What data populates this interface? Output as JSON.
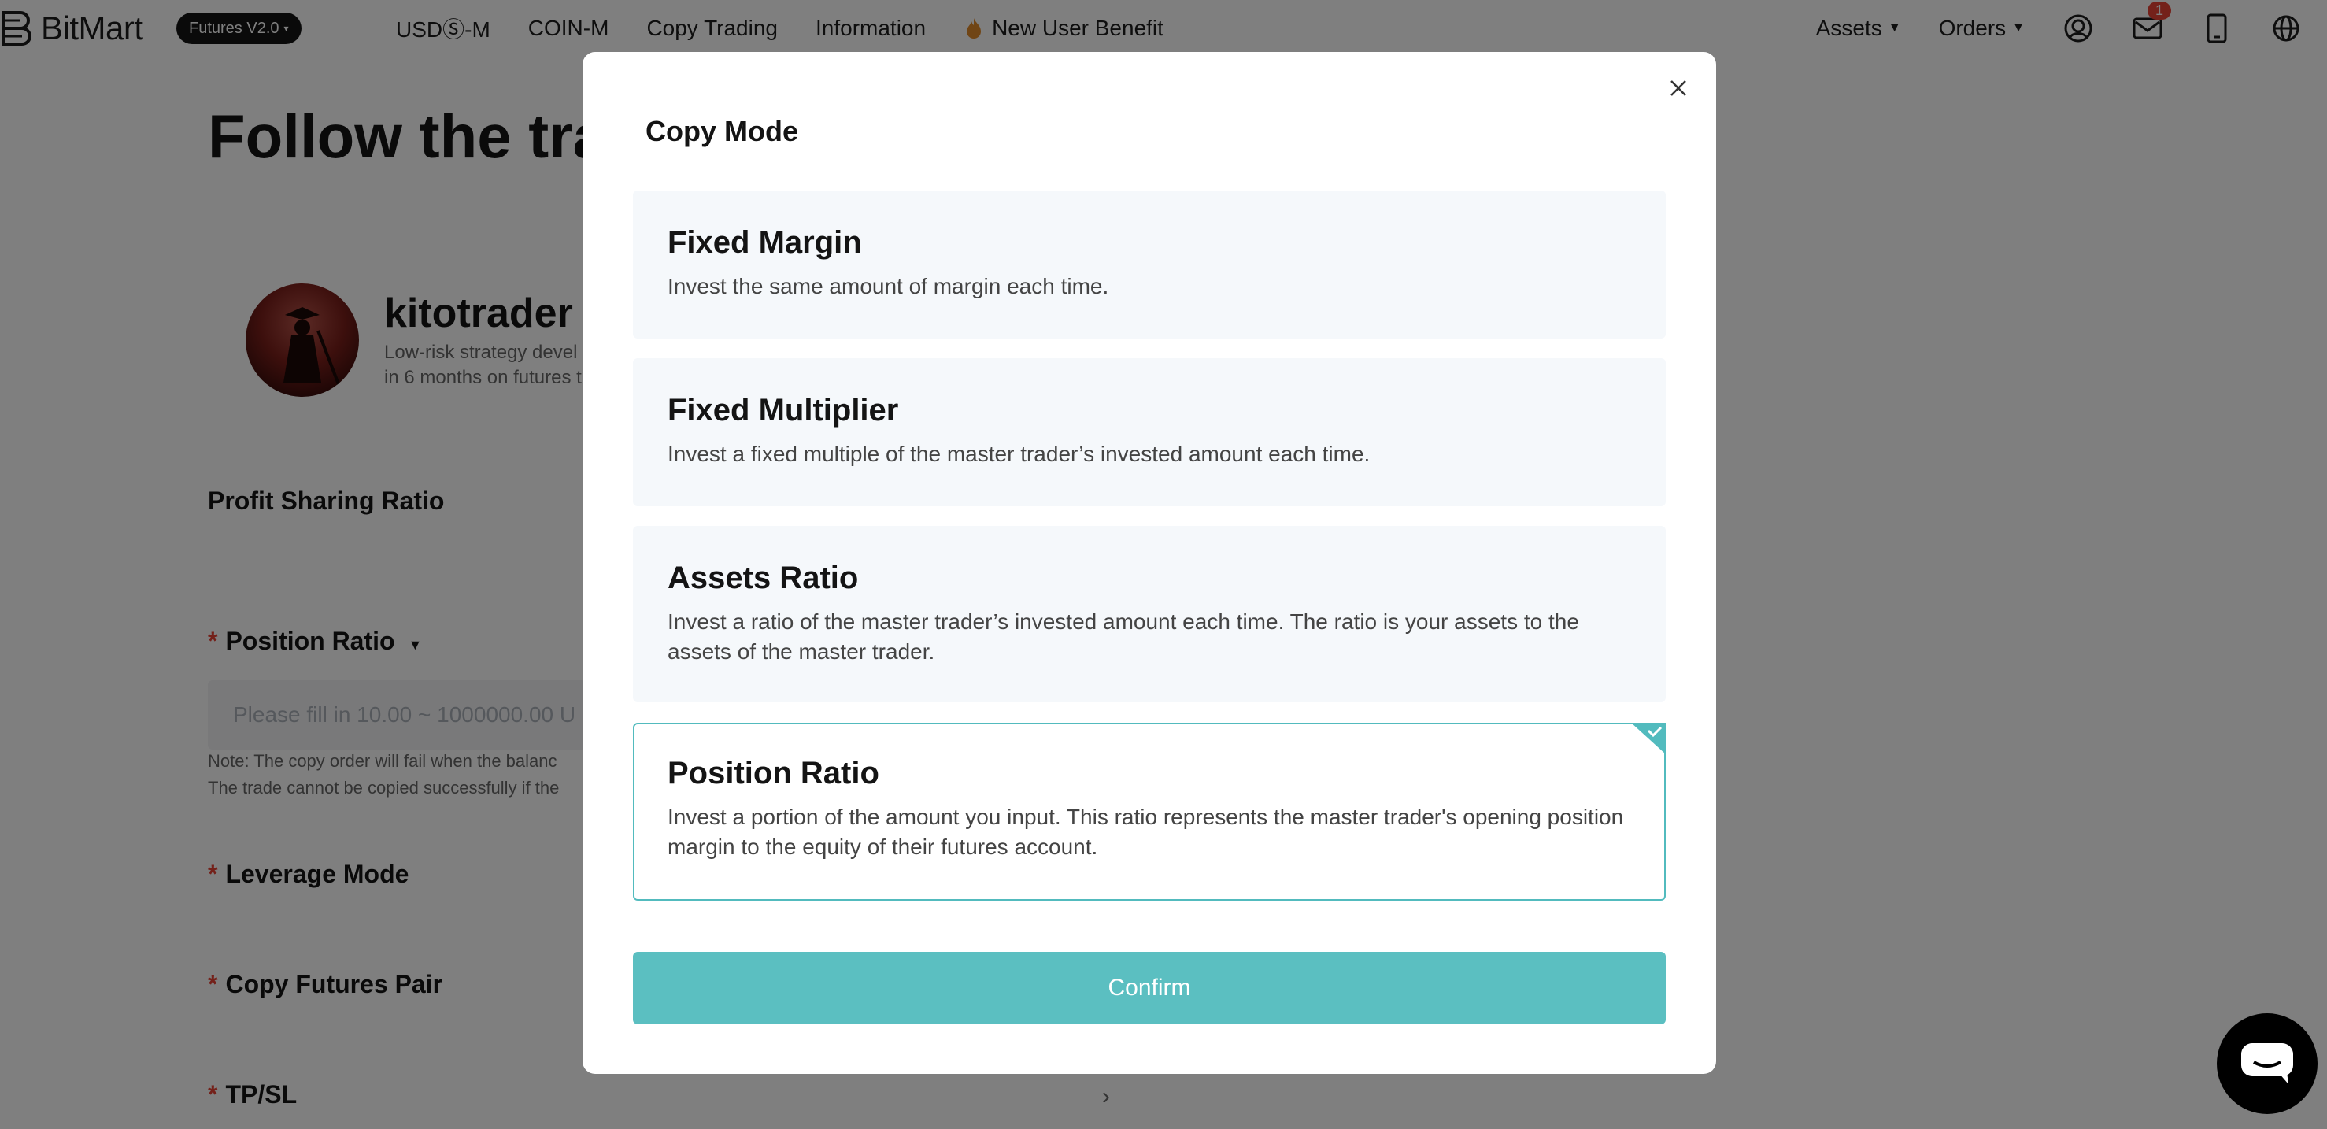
{
  "header": {
    "brand": "BitMart",
    "version_label": "Futures V2.0",
    "nav_links": [
      "USDⓈ-M",
      "COIN-M",
      "Copy Trading",
      "Information"
    ],
    "new_user_benefit": "New User Benefit",
    "assets_label": "Assets",
    "orders_label": "Orders",
    "notification_count": "1"
  },
  "page": {
    "title": "Follow the trad",
    "trader_name": "kitotrader",
    "trader_desc_line1": "Low-risk strategy devel",
    "trader_desc_line2": "in 6 months on futures t",
    "profit_sharing_label": "Profit Sharing Ratio",
    "position_ratio_label": "Position Ratio",
    "position_ratio_placeholder": "Please fill in 10.00 ~ 1000000.00 U",
    "note_line1": "Note: The copy order will fail when the balanc",
    "note_line2": "The trade cannot be copied successfully if the",
    "leverage_mode_label": "Leverage Mode",
    "copy_futures_pair_label": "Copy Futures Pair",
    "tpsl_label": "TP/SL"
  },
  "modal": {
    "title": "Copy Mode",
    "options": [
      {
        "title": "Fixed Margin",
        "desc": "Invest the same amount of margin each time."
      },
      {
        "title": "Fixed Multiplier",
        "desc": "Invest a fixed multiple of the master trader’s invested amount each time."
      },
      {
        "title": "Assets Ratio",
        "desc": "Invest a ratio of the master trader’s invested amount each time. The ratio is your assets to the assets of the master trader."
      },
      {
        "title": "Position Ratio",
        "desc": "Invest a portion of the amount you input. This ratio represents the master trader's opening position margin to the equity of their futures account."
      }
    ],
    "selected_option": "Position Ratio",
    "confirm_label": "Confirm"
  },
  "colors": {
    "accent": "#52bbbe",
    "confirm_bg": "#5bbfc1",
    "option_bg": "#f5f8fb",
    "required": "#e94235"
  }
}
